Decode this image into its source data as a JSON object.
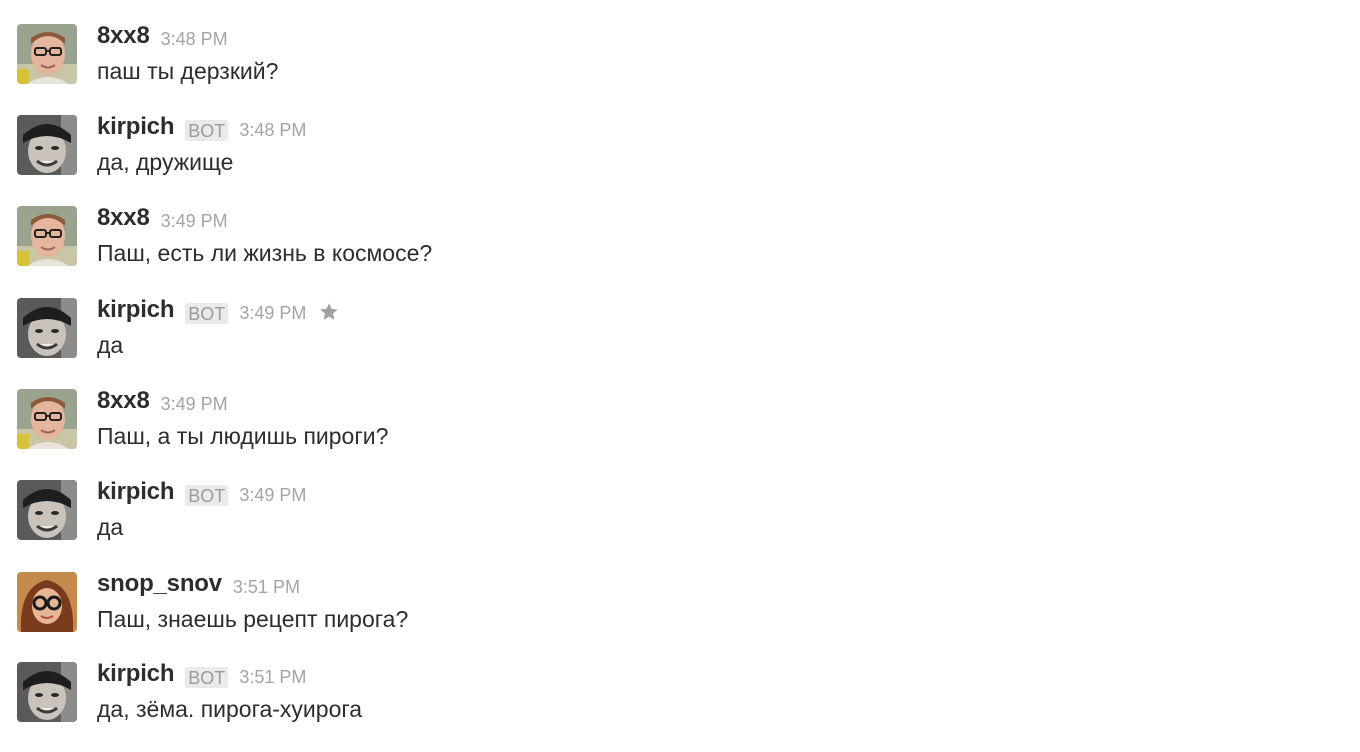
{
  "messages": [
    {
      "author": "8xx8",
      "is_bot": false,
      "bot_label": "",
      "time": "3:48 PM",
      "text": "паш ты дерзкий?",
      "avatar": "8xx8-avatar",
      "starred": false
    },
    {
      "author": "kirpich",
      "is_bot": true,
      "bot_label": "BOT",
      "time": "3:48 PM",
      "text": "да, дружище",
      "avatar": "kirpich-avatar",
      "starred": false
    },
    {
      "author": "8xx8",
      "is_bot": false,
      "bot_label": "",
      "time": "3:49 PM",
      "text": "Паш, есть ли жизнь в космосе?",
      "avatar": "8xx8-avatar",
      "starred": false
    },
    {
      "author": "kirpich",
      "is_bot": true,
      "bot_label": "BOT",
      "time": "3:49 PM",
      "text": "да",
      "avatar": "kirpich-avatar",
      "starred": true
    },
    {
      "author": "8xx8",
      "is_bot": false,
      "bot_label": "",
      "time": "3:49 PM",
      "text": "Паш, а ты людишь пироги?",
      "avatar": "8xx8-avatar",
      "starred": false
    },
    {
      "author": "kirpich",
      "is_bot": true,
      "bot_label": "BOT",
      "time": "3:49 PM",
      "text": "да",
      "avatar": "kirpich-avatar",
      "starred": false
    },
    {
      "author": "snop_snov",
      "is_bot": false,
      "bot_label": "",
      "time": "3:51 PM",
      "text": "Паш, знаешь рецепт пирога?",
      "avatar": "snop_snov-avatar",
      "starred": false
    },
    {
      "author": "kirpich",
      "is_bot": true,
      "bot_label": "BOT",
      "time": "3:51 PM",
      "text": "да, зёма. пирога-хуирога",
      "avatar": "kirpich-avatar",
      "starred": false
    }
  ],
  "icons": {
    "star": "star-icon"
  },
  "colors": {
    "text": "#2c2d30",
    "timestamp": "#a3a4a7",
    "bot_tag_bg": "#eaeaea",
    "bot_tag_text": "#9a9b9e",
    "star": "#a0a1a4"
  }
}
